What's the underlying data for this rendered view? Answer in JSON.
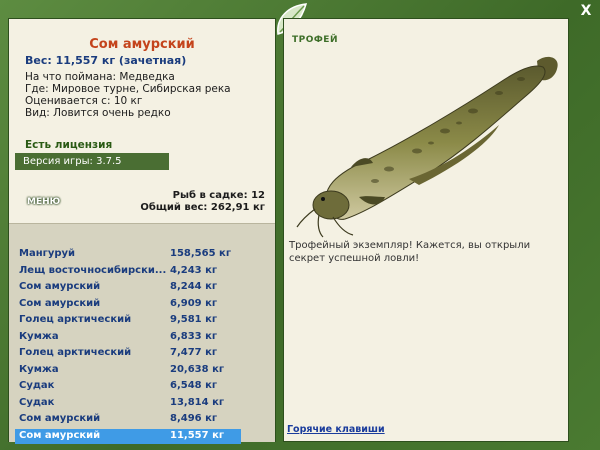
{
  "window": {
    "close_label": "X"
  },
  "fish": {
    "title": "Сом амурский",
    "weight_line": "Вес: 11,557 кг (зачетная)",
    "caught_with": "На что поймана: Медведка",
    "location": "Где: Мировое турне, Сибирская река",
    "valued_from": "Оценивается с: 10 кг",
    "rarity": "Вид: Ловится очень редко"
  },
  "license_label": "Есть лицензия",
  "version_label": "Версия игры: 3.7.5",
  "menu_label": "МЕНЮ",
  "stats": {
    "fish_count": "Рыб в садке: 12",
    "total_weight": "Общий вес: 262,91 кг"
  },
  "catch_list": [
    {
      "name": "Мангуруй",
      "weight": "158,565 кг"
    },
    {
      "name": "Лещ восточносибирски...",
      "weight": "4,243 кг"
    },
    {
      "name": "Сом амурский",
      "weight": "8,244 кг"
    },
    {
      "name": "Сом амурский",
      "weight": "6,909 кг"
    },
    {
      "name": "Голец арктический",
      "weight": "9,581 кг"
    },
    {
      "name": "Кумжа",
      "weight": "6,833 кг"
    },
    {
      "name": "Голец арктический",
      "weight": "7,477 кг"
    },
    {
      "name": "Кумжа",
      "weight": "20,638 кг"
    },
    {
      "name": "Судак",
      "weight": "6,548 кг"
    },
    {
      "name": "Судак",
      "weight": "13,814 кг"
    },
    {
      "name": "Сом амурский",
      "weight": "8,496 кг"
    },
    {
      "name": "Сом амурский",
      "weight": "11,557 кг"
    }
  ],
  "selected_index": 11,
  "trophy": {
    "tag": "ТРОФЕЙ",
    "message": "Трофейный экземпляр! Кажется, вы открыли секрет успешной ловли!"
  },
  "hotkeys_label": "Горячие клавиши",
  "icons": {
    "leaf": "leaf-icon",
    "fish": "catfish-image"
  },
  "colors": {
    "frame_green": "#4f7d35",
    "panel_bg": "#f4f1e3",
    "title_red": "#c4441c",
    "link_blue": "#1a3c7e",
    "selection_blue": "#3f9be6"
  }
}
